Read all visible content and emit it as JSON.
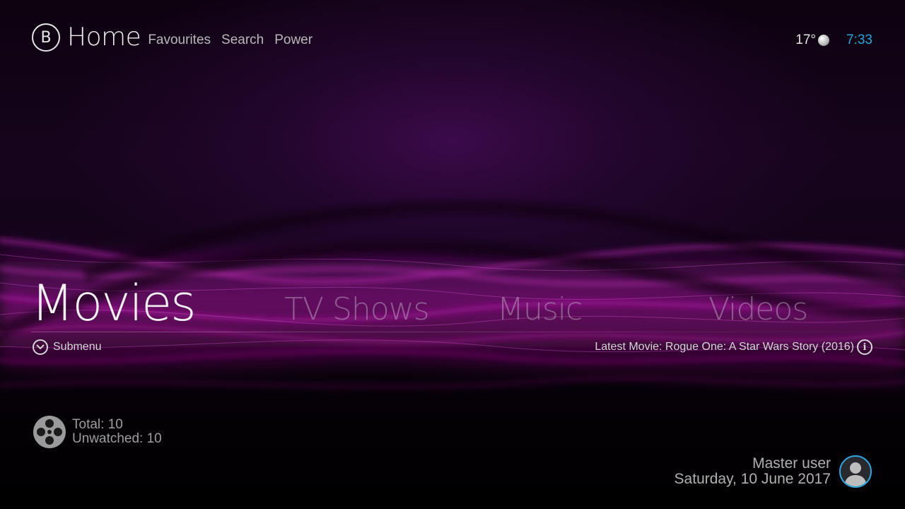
{
  "header": {
    "logo_letter": "B",
    "title": "Home",
    "nav": [
      "Favourites",
      "Search",
      "Power"
    ]
  },
  "status": {
    "temperature": "17°",
    "weather_icon": "weather-cloudy-icon",
    "time": "7:33"
  },
  "main_menu": {
    "items": [
      {
        "label": "Movies",
        "active": true
      },
      {
        "label": "TV Shows",
        "active": false
      },
      {
        "label": "Music",
        "active": false
      },
      {
        "label": "Videos",
        "active": false
      }
    ]
  },
  "submenu": {
    "label": "Submenu",
    "icon": "chevron-down-circle-icon"
  },
  "latest": {
    "text": "Latest Movie: Rogue One: A Star Wars Story (2016)",
    "icon": "info-circle-icon"
  },
  "stats": {
    "icon": "film-reel-icon",
    "total": "Total: 10",
    "unwatched": "Unwatched: 10"
  },
  "user": {
    "name": "Master user",
    "date": "Saturday, 10 June 2017",
    "avatar_icon": "user-avatar-icon"
  },
  "colors": {
    "accent": "#2aa6e0",
    "background_purple": "#3b0a4a",
    "wave_magenta": "#c21ab8"
  }
}
